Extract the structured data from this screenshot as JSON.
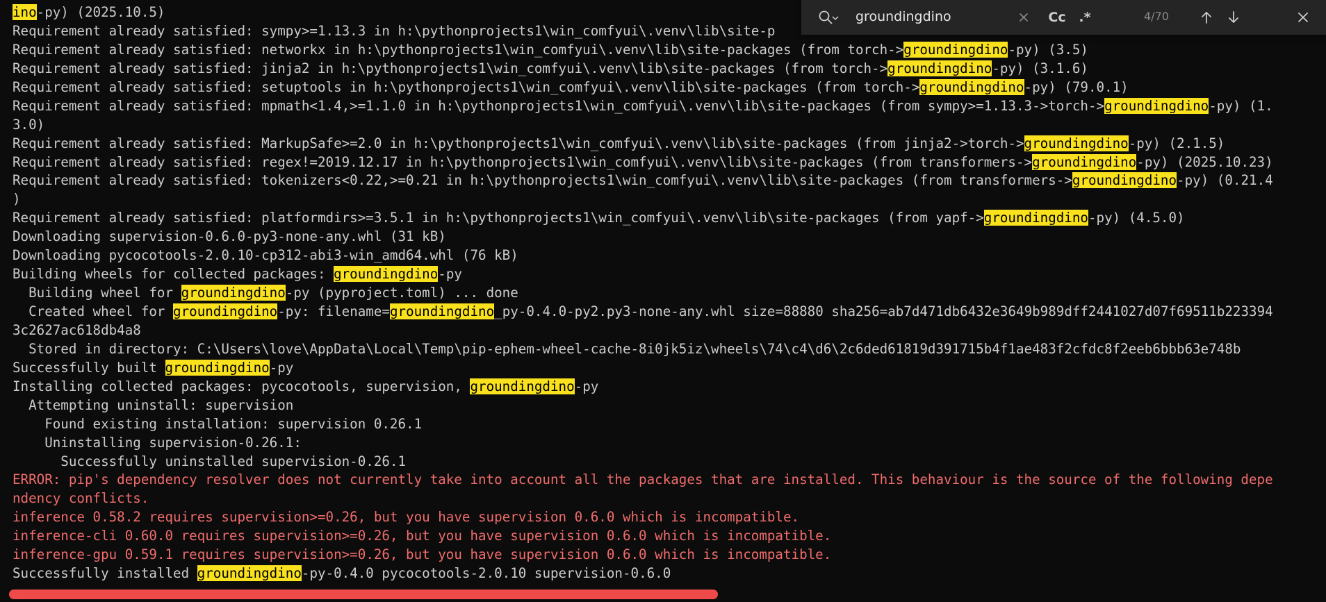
{
  "terminal": {
    "lines": [
      {
        "type": "normal",
        "segments": [
          {
            "t": "ino",
            "hl": true
          },
          {
            "t": "-py) (2025.10.5)",
            "hl": false
          }
        ]
      },
      {
        "type": "normal",
        "segments": [
          {
            "t": "Requirement already satisfied: sympy>=1.13.3 in h:\\pythonprojects1\\win_comfyui\\.venv\\lib\\site-p",
            "hl": false
          }
        ]
      },
      {
        "type": "normal",
        "segments": [
          {
            "t": "Requirement already satisfied: networkx in h:\\pythonprojects1\\win_comfyui\\.venv\\lib\\site-packages (from torch->",
            "hl": false
          },
          {
            "t": "groundingdino",
            "hl": true
          },
          {
            "t": "-py) (3.5)",
            "hl": false
          }
        ]
      },
      {
        "type": "normal",
        "segments": [
          {
            "t": "Requirement already satisfied: jinja2 in h:\\pythonprojects1\\win_comfyui\\.venv\\lib\\site-packages (from torch->",
            "hl": false
          },
          {
            "t": "groundingdino",
            "hl": true
          },
          {
            "t": "-py) (3.1.6)",
            "hl": false
          }
        ]
      },
      {
        "type": "normal",
        "segments": [
          {
            "t": "Requirement already satisfied: setuptools in h:\\pythonprojects1\\win_comfyui\\.venv\\lib\\site-packages (from torch->",
            "hl": false
          },
          {
            "t": "groundingdino",
            "hl": true
          },
          {
            "t": "-py) (79.0.1)",
            "hl": false
          }
        ]
      },
      {
        "type": "normal",
        "segments": [
          {
            "t": "Requirement already satisfied: mpmath<1.4,>=1.1.0 in h:\\pythonprojects1\\win_comfyui\\.venv\\lib\\site-packages (from sympy>=1.13.3->torch->",
            "hl": false
          },
          {
            "t": "groundingdino",
            "hl": true
          },
          {
            "t": "-py) (1.",
            "hl": false
          }
        ]
      },
      {
        "type": "normal",
        "segments": [
          {
            "t": "3.0)",
            "hl": false
          }
        ]
      },
      {
        "type": "normal",
        "segments": [
          {
            "t": "Requirement already satisfied: MarkupSafe>=2.0 in h:\\pythonprojects1\\win_comfyui\\.venv\\lib\\site-packages (from jinja2->torch->",
            "hl": false
          },
          {
            "t": "groundingdino",
            "hl": true
          },
          {
            "t": "-py) (2.1.5)",
            "hl": false
          }
        ]
      },
      {
        "type": "normal",
        "segments": [
          {
            "t": "Requirement already satisfied: regex!=2019.12.17 in h:\\pythonprojects1\\win_comfyui\\.venv\\lib\\site-packages (from transformers->",
            "hl": false
          },
          {
            "t": "groundingdino",
            "hl": true
          },
          {
            "t": "-py) (2025.10.23)",
            "hl": false
          }
        ]
      },
      {
        "type": "normal",
        "segments": [
          {
            "t": "Requirement already satisfied: tokenizers<0.22,>=0.21 in h:\\pythonprojects1\\win_comfyui\\.venv\\lib\\site-packages (from transformers->",
            "hl": false
          },
          {
            "t": "groundingdino",
            "hl": true
          },
          {
            "t": "-py) (0.21.4",
            "hl": false
          }
        ]
      },
      {
        "type": "normal",
        "segments": [
          {
            "t": ")",
            "hl": false
          }
        ]
      },
      {
        "type": "normal",
        "segments": [
          {
            "t": "Requirement already satisfied: platformdirs>=3.5.1 in h:\\pythonprojects1\\win_comfyui\\.venv\\lib\\site-packages (from yapf->",
            "hl": false
          },
          {
            "t": "groundingdino",
            "hl": true
          },
          {
            "t": "-py) (4.5.0)",
            "hl": false
          }
        ]
      },
      {
        "type": "normal",
        "segments": [
          {
            "t": "Downloading supervision-0.6.0-py3-none-any.whl (31 kB)",
            "hl": false
          }
        ]
      },
      {
        "type": "normal",
        "segments": [
          {
            "t": "Downloading pycocotools-2.0.10-cp312-abi3-win_amd64.whl (76 kB)",
            "hl": false
          }
        ]
      },
      {
        "type": "normal",
        "segments": [
          {
            "t": "Building wheels for collected packages: ",
            "hl": false
          },
          {
            "t": "groundingdino",
            "hl": true
          },
          {
            "t": "-py",
            "hl": false
          }
        ]
      },
      {
        "type": "normal",
        "segments": [
          {
            "t": "  Building wheel for ",
            "hl": false
          },
          {
            "t": "groundingdino",
            "hl": true
          },
          {
            "t": "-py (pyproject.toml) ... done",
            "hl": false
          }
        ]
      },
      {
        "type": "normal",
        "segments": [
          {
            "t": "  Created wheel for ",
            "hl": false
          },
          {
            "t": "groundingdino",
            "hl": true
          },
          {
            "t": "-py: filename=",
            "hl": false
          },
          {
            "t": "groundingdino",
            "hl": true
          },
          {
            "t": "_py-0.4.0-py2.py3-none-any.whl size=88880 sha256=ab7d471db6432e3649b989dff2441027d07f69511b223394",
            "hl": false
          }
        ]
      },
      {
        "type": "normal",
        "segments": [
          {
            "t": "3c2627ac618db4a8",
            "hl": false
          }
        ]
      },
      {
        "type": "normal",
        "segments": [
          {
            "t": "  Stored in directory: C:\\Users\\love\\AppData\\Local\\Temp\\pip-ephem-wheel-cache-8i0jk5iz\\wheels\\74\\c4\\d6\\2c6ded61819d391715b4f1ae483f2cfdc8f2eeb6bbb63e748b",
            "hl": false
          }
        ]
      },
      {
        "type": "normal",
        "segments": [
          {
            "t": "Successfully built ",
            "hl": false
          },
          {
            "t": "groundingdino",
            "hl": true
          },
          {
            "t": "-py",
            "hl": false
          }
        ]
      },
      {
        "type": "normal",
        "segments": [
          {
            "t": "Installing collected packages: pycocotools, supervision, ",
            "hl": false
          },
          {
            "t": "groundingdino",
            "hl": true
          },
          {
            "t": "-py",
            "hl": false
          }
        ]
      },
      {
        "type": "normal",
        "segments": [
          {
            "t": "  Attempting uninstall: supervision",
            "hl": false
          }
        ]
      },
      {
        "type": "normal",
        "segments": [
          {
            "t": "    Found existing installation: supervision 0.26.1",
            "hl": false
          }
        ]
      },
      {
        "type": "normal",
        "segments": [
          {
            "t": "    Uninstalling supervision-0.26.1:",
            "hl": false
          }
        ]
      },
      {
        "type": "normal",
        "segments": [
          {
            "t": "      Successfully uninstalled supervision-0.26.1",
            "hl": false
          }
        ]
      },
      {
        "type": "error",
        "segments": [
          {
            "t": "ERROR: pip's dependency resolver does not currently take into account all the packages that are installed. This behaviour is the source of the following depe",
            "hl": false
          }
        ]
      },
      {
        "type": "error",
        "segments": [
          {
            "t": "ndency conflicts.",
            "hl": false
          }
        ]
      },
      {
        "type": "error",
        "segments": [
          {
            "t": "inference 0.58.2 requires supervision>=0.26, but you have supervision 0.6.0 which is incompatible.",
            "hl": false
          }
        ]
      },
      {
        "type": "error",
        "segments": [
          {
            "t": "inference-cli 0.60.0 requires supervision>=0.26, but you have supervision 0.6.0 which is incompatible.",
            "hl": false
          }
        ]
      },
      {
        "type": "error",
        "segments": [
          {
            "t": "inference-gpu 0.59.1 requires supervision>=0.26, but you have supervision 0.6.0 which is incompatible.",
            "hl": false
          }
        ]
      },
      {
        "type": "normal",
        "segments": [
          {
            "t": "Successfully installed ",
            "hl": false
          },
          {
            "t": "groundingdino",
            "hl": true
          },
          {
            "t": "-py-0.4.0 pycocotools-2.0.10 supervision-0.6.0",
            "hl": false
          }
        ]
      }
    ]
  },
  "find": {
    "query": "groundingdino",
    "case_label": "Cc",
    "regex_label": ".*",
    "match_count": "4/70",
    "icons": {
      "search": "search-icon",
      "dropdown": "chevron-down-icon",
      "clear": "close-icon",
      "prev": "arrow-up-icon",
      "next": "arrow-down-icon",
      "close": "close-icon"
    }
  },
  "colors": {
    "background": "#0c0c0c",
    "text": "#cccccc",
    "error": "#f16c6c",
    "highlight": "#f9e21d",
    "bottom_bar": "#ee4a4a",
    "find_bg": "#252526"
  }
}
